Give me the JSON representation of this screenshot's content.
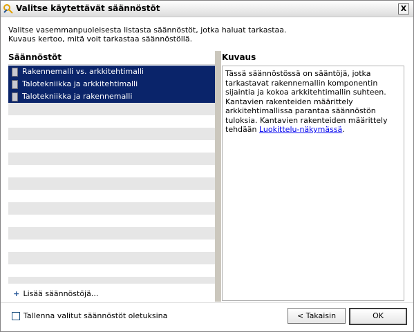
{
  "window": {
    "title": "Valitse käytettävät säännöstöt",
    "close_label": "X"
  },
  "intro": {
    "line1": "Valitse vasemmanpuoleisesta listasta säännöstöt, jotka haluat tarkastaa.",
    "line2": "Kuvaus kertoo, mitä voit tarkastaa säännöstöllä."
  },
  "rules": {
    "header": "Säännöstöt",
    "items": [
      {
        "label": "Rakennemalli vs. arkkitehtimalli",
        "selected": true
      },
      {
        "label": "Talotekniikka ja arkkitehtimalli",
        "selected": true
      },
      {
        "label": "Talotekniikka ja rakennemalli",
        "selected": true
      }
    ],
    "add_label": "Lisää säännöstöjä..."
  },
  "description": {
    "header": "Kuvaus",
    "text": "Tässä säännöstössä on sääntöjä, jotka tarkastavat rakennemallin komponentin sijaintia ja kokoa arkkitehtimallin suhteen. Kantavien rakenteiden määrittely arkkitehtimallissa parantaa säännöstön tuloksia. Kantavien rakenteiden määrittely tehdään ",
    "link": "Luokittelu-näkymässä",
    "suffix": "."
  },
  "footer": {
    "save_default_label": "Tallenna valitut säännöstöt oletuksina",
    "save_default_checked": false,
    "back_label": "< Takaisin",
    "ok_label": "OK"
  },
  "colors": {
    "selection": "#0a246a",
    "dialog_bg": "#ece9d8",
    "link": "#0000ee"
  }
}
